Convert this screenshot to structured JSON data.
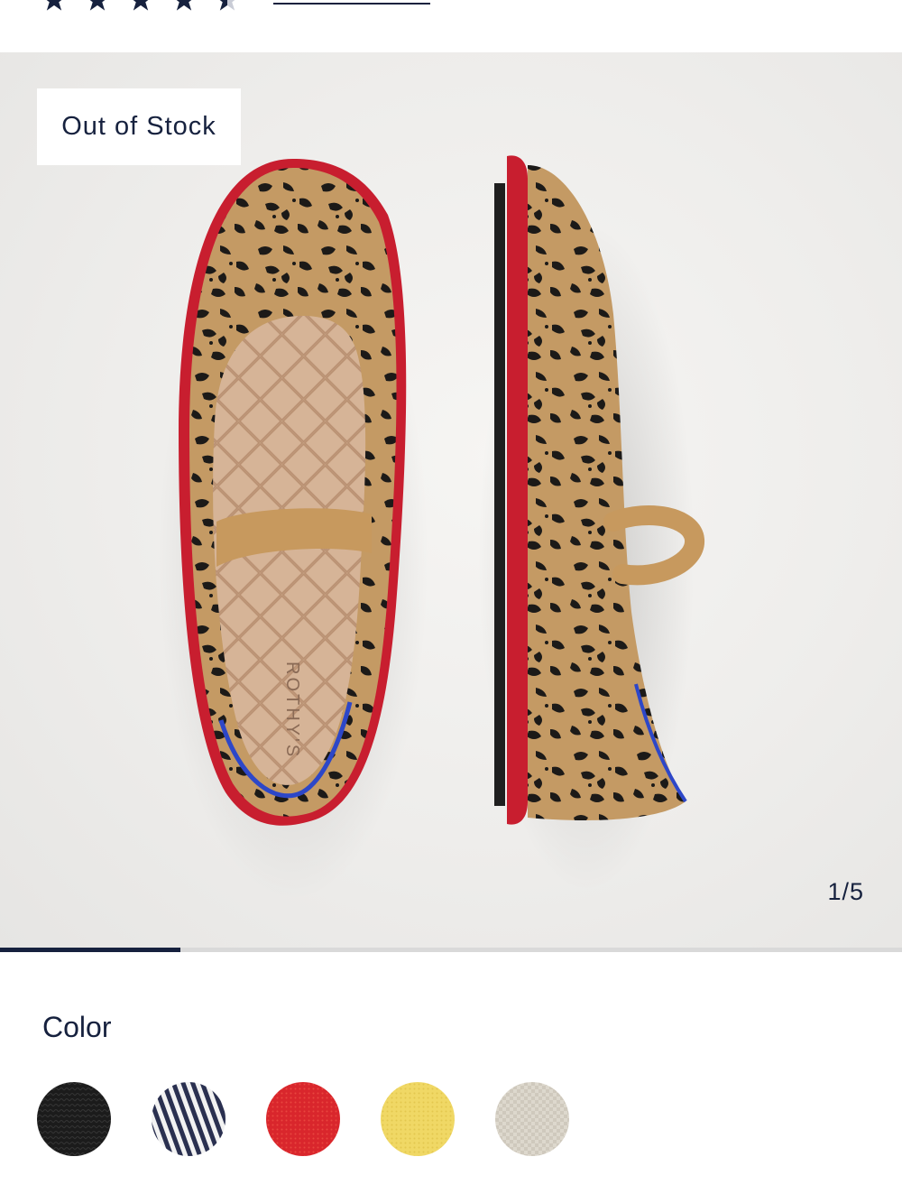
{
  "rating": {
    "stars_filled": 4.5,
    "stars_total": 5,
    "color": "#16213e",
    "review_link_text": ""
  },
  "gallery": {
    "badge": "Out of Stock",
    "counter": "1/5",
    "progress_fraction": 0.2,
    "product_alt": "Leopard print knit Mary Jane flat with red sole",
    "insole_brand": "ROTHY'S"
  },
  "color_section": {
    "title": "Color",
    "swatches": [
      {
        "name": "black-knit",
        "color": "#1b1b1b"
      },
      {
        "name": "navy-white-stripe",
        "color": "#2a3050"
      },
      {
        "name": "red-knit",
        "color": "#d9262c"
      },
      {
        "name": "yellow-knit",
        "color": "#f0d865"
      },
      {
        "name": "cream-knit",
        "color": "#ddd8cd"
      }
    ]
  },
  "colors": {
    "navy": "#16213e",
    "sole_red": "#c81e2f",
    "leopard_base": "#c49a64",
    "leopard_spot": "#1c1a18"
  }
}
